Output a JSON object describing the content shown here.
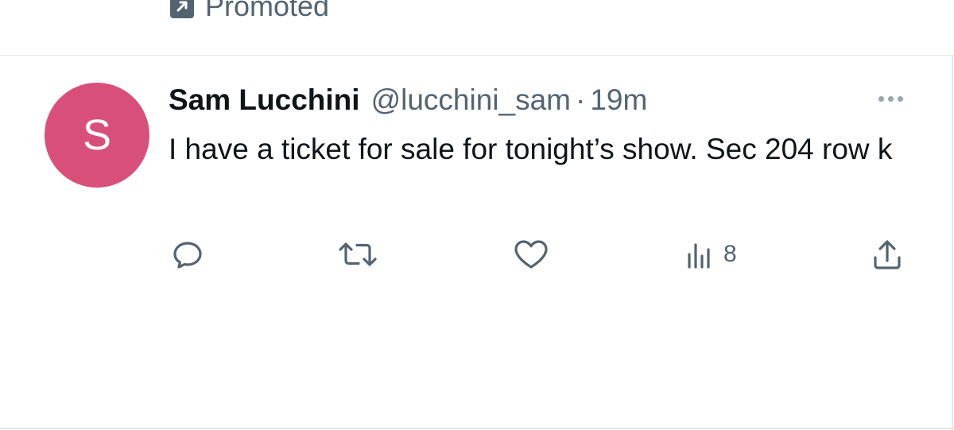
{
  "promoted": {
    "label": "Promoted",
    "icon": "promoted-arrow-icon"
  },
  "tweet": {
    "avatar_letter": "S",
    "avatar_color": "#d8507a",
    "display_name": "Sam Lucchini",
    "handle": "@lucchini_sam",
    "separator": "·",
    "time": "19m",
    "text": "I have a ticket for sale for tonight’s show. Sec 204 row k",
    "more_icon": "more-dots-icon"
  },
  "actions": {
    "reply_icon": "reply-icon",
    "retweet_icon": "retweet-icon",
    "like_icon": "like-heart-icon",
    "views_icon": "views-chart-icon",
    "views_count": "8",
    "share_icon": "share-icon"
  },
  "colors": {
    "text_primary": "#0f1419",
    "text_secondary": "#536471",
    "divider": "#e4e8ec"
  }
}
